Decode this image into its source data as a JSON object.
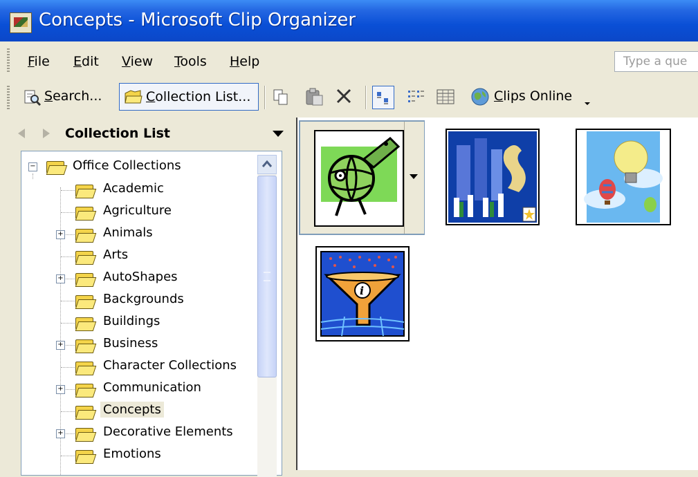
{
  "window": {
    "title": "Concepts - Microsoft Clip Organizer"
  },
  "menu": {
    "items": [
      {
        "pre": "",
        "ul": "F",
        "post": "ile"
      },
      {
        "pre": "",
        "ul": "E",
        "post": "dit"
      },
      {
        "pre": "",
        "ul": "V",
        "post": "iew"
      },
      {
        "pre": "",
        "ul": "T",
        "post": "ools"
      },
      {
        "pre": "",
        "ul": "H",
        "post": "elp"
      }
    ],
    "help_placeholder": "Type a que"
  },
  "toolbar": {
    "search": {
      "ul": "S",
      "post": "earch..."
    },
    "collection_list": {
      "ul": "C",
      "post": "ollection List..."
    },
    "clips_online": {
      "ul": "C",
      "post": "lips Online"
    }
  },
  "pane": {
    "header": "Collection List"
  },
  "tree": {
    "root": "Office Collections",
    "items": [
      {
        "label": "Academic",
        "expandable": false
      },
      {
        "label": "Agriculture",
        "expandable": false
      },
      {
        "label": "Animals",
        "expandable": true
      },
      {
        "label": "Arts",
        "expandable": false
      },
      {
        "label": "AutoShapes",
        "expandable": true
      },
      {
        "label": "Backgrounds",
        "expandable": false
      },
      {
        "label": "Buildings",
        "expandable": false
      },
      {
        "label": "Business",
        "expandable": true
      },
      {
        "label": "Character Collections",
        "expandable": false
      },
      {
        "label": "Communication",
        "expandable": true
      },
      {
        "label": "Concepts",
        "expandable": false,
        "selected": true
      },
      {
        "label": "Decorative Elements",
        "expandable": true
      },
      {
        "label": "Emotions",
        "expandable": false
      }
    ]
  },
  "clips": {
    "names": [
      "globe-rocket-clip",
      "business-people-clip",
      "lightbulb-balloon-clip",
      "information-funnel-clip"
    ]
  },
  "colors": {
    "titlebar": "#0b4fd6",
    "selection": "#ece9d8",
    "face": "#ece9d8"
  }
}
